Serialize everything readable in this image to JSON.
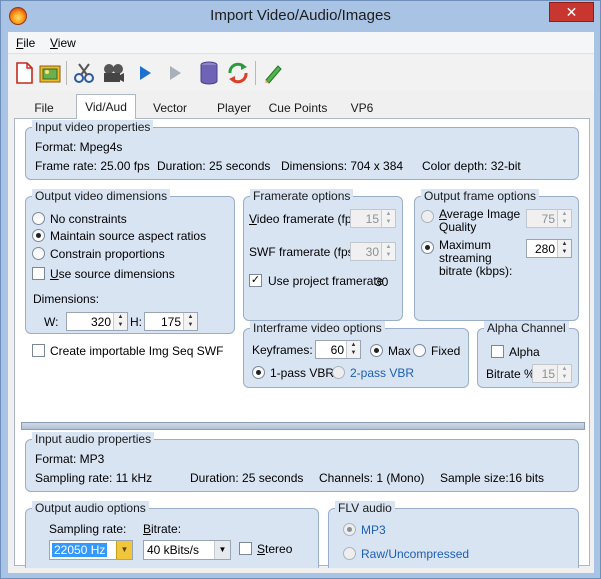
{
  "window": {
    "title": "Import Video/Audio/Images",
    "close_label": "✕"
  },
  "menu": {
    "file": {
      "mnemonic": "F",
      "rest": "ile"
    },
    "view": {
      "mnemonic": "V",
      "rest": "iew"
    }
  },
  "toolbar": {
    "icons": [
      "new-document-icon",
      "open-image-icon",
      "cut-icon",
      "film-reel-icon",
      "play-icon",
      "play-disabled-icon",
      "database-icon",
      "refresh-icon",
      "pencil-icon"
    ]
  },
  "tabs": [
    {
      "label": "File"
    },
    {
      "label": "Vid/Aud",
      "active": true
    },
    {
      "label": "Vector"
    },
    {
      "label": "Player"
    },
    {
      "label": "Cue Points"
    },
    {
      "label": "VP6"
    }
  ],
  "input_video": {
    "legend": "Input video properties",
    "format": "Format:  Mpeg4s",
    "frame_rate": "Frame rate: 25.00 fps",
    "duration": "Duration:  25 seconds",
    "dimensions": "Dimensions:  704 x 384",
    "color_depth": "Color depth: 32-bit"
  },
  "output_dimensions": {
    "legend": "Output video dimensions",
    "options": [
      {
        "label": "No constraints",
        "selected": false
      },
      {
        "label": "Maintain source aspect ratios",
        "selected": true
      },
      {
        "label": "Constrain proportions",
        "selected": false
      }
    ],
    "use_source_u": "U",
    "use_source_rest": "se source dimensions",
    "dimensions_label": "Dimensions:",
    "w_label": "W:",
    "w_value": "320",
    "h_label": "H:",
    "h_value": "175"
  },
  "create_importable": "Create importable Img Seq SWF",
  "framerate": {
    "legend": "Framerate options",
    "video_u": "V",
    "video_rest": "ideo framerate (fp...",
    "video_value": "15",
    "swf_label": "SWF framerate (fps):",
    "swf_value": "30",
    "use_project_label": "Use project framerate",
    "use_project_value": "30"
  },
  "output_frame": {
    "legend": "Output frame options",
    "avg_u": "A",
    "avg_rest": "verage Image Quality",
    "avg_value": "75",
    "max_label": "Maximum streaming bitrate (kbps):",
    "max_value": "280"
  },
  "interframe": {
    "legend": "Interframe video options",
    "keyframes_label": "Keyframes:",
    "keyframes_value": "60",
    "max_label": "Max",
    "fixed_label": "Fixed",
    "pass1_label": "1-pass VBR",
    "pass2_label": "2-pass VBR"
  },
  "alpha": {
    "legend": "Alpha Channel",
    "alpha_label": "Alpha",
    "bitrate_label": "Bitrate %:",
    "bitrate_value": "15"
  },
  "input_audio": {
    "legend": "Input audio properties",
    "format": "Format:  MP3",
    "sampling": "Sampling rate:  11 kHz",
    "duration": "Duration:  25 seconds",
    "channels": "Channels:  1 (Mono)",
    "sample_size": "Sample size:16 bits"
  },
  "output_audio": {
    "legend": "Output audio options",
    "sampling_label": "Sampling rate:",
    "sampling_value": "22050 Hz",
    "bitrate_u": "B",
    "bitrate_rest": "itrate:",
    "bitrate_value": "40 kBits/s",
    "stereo_u": "S",
    "stereo_rest": "tereo"
  },
  "flv_audio": {
    "legend": "FLV audio",
    "mp3_label": "MP3",
    "raw_label": "Raw/Uncompressed"
  },
  "colors": {
    "frame": "#a8c3e3",
    "group_bg": "#d9e4f3",
    "close": "#c7372f",
    "link": "#1c5fb3"
  }
}
